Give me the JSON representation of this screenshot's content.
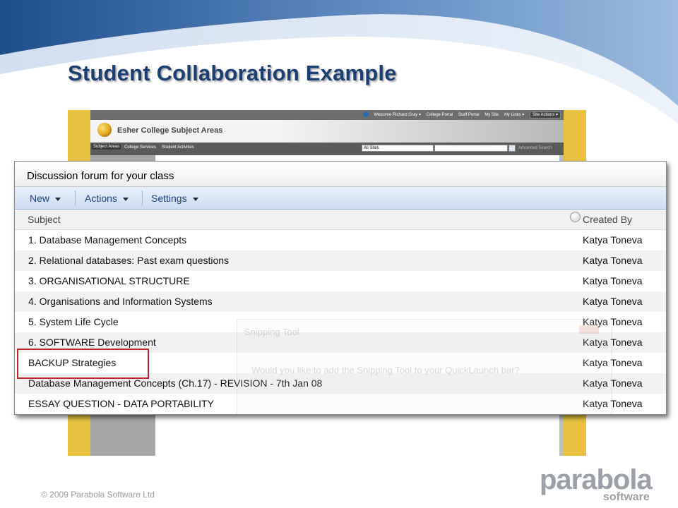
{
  "slide": {
    "title": "Student Collaboration Example",
    "footer": "© 2009 Parabola Software Ltd",
    "brand": {
      "name": "parabola",
      "tagline": "software"
    }
  },
  "portal": {
    "topbar": {
      "welcome": "Welcome Richard Gray ▾",
      "links": [
        "College Portal",
        "Staff Portal",
        "My Site",
        "My Links ▾"
      ],
      "site_actions": "Site Actions ▾"
    },
    "site_title": "Esher College Subject Areas",
    "tabs": [
      "Subject Areas",
      "College Services",
      "Student Activities"
    ],
    "search": {
      "scope": "All Sites",
      "placeholder": "",
      "advanced": "Advanced Search"
    }
  },
  "forum": {
    "title": "Discussion forum for your class",
    "toolbar": {
      "new": "New",
      "actions": "Actions",
      "settings": "Settings"
    },
    "columns": {
      "subject": "Subject",
      "created_by": "Created By"
    },
    "rows": [
      {
        "subject": "1. Database Management Concepts",
        "author": "Katya Toneva"
      },
      {
        "subject": "2. Relational databases: Past exam questions",
        "author": "Katya Toneva"
      },
      {
        "subject": "3. ORGANISATIONAL STRUCTURE",
        "author": "Katya Toneva"
      },
      {
        "subject": "4. Organisations and Information Systems",
        "author": "Katya Toneva"
      },
      {
        "subject": "5. System Life Cycle",
        "author": "Katya Toneva"
      },
      {
        "subject": "6. SOFTWARE Development",
        "author": "Katya Toneva"
      },
      {
        "subject": "BACKUP Strategies",
        "author": "Katya Toneva"
      },
      {
        "subject": "Database Management Concepts (Ch.17) - REVISION - 7th Jan 08",
        "author": "Katya Toneva"
      },
      {
        "subject": "ESSAY QUESTION - DATA PORTABILITY",
        "author": "Katya Toneva"
      }
    ],
    "highlighted_row": "BACKUP Strategies"
  },
  "ghost_popup": {
    "title": "Snipping Tool",
    "body": "Would you like to add the Snipping Tool to your QuickLaunch bar?"
  },
  "colors": {
    "title": "#1c3f73",
    "highlight": "#c0272d",
    "frame": "#e8c23f",
    "toolbar": "#cddcf1"
  }
}
